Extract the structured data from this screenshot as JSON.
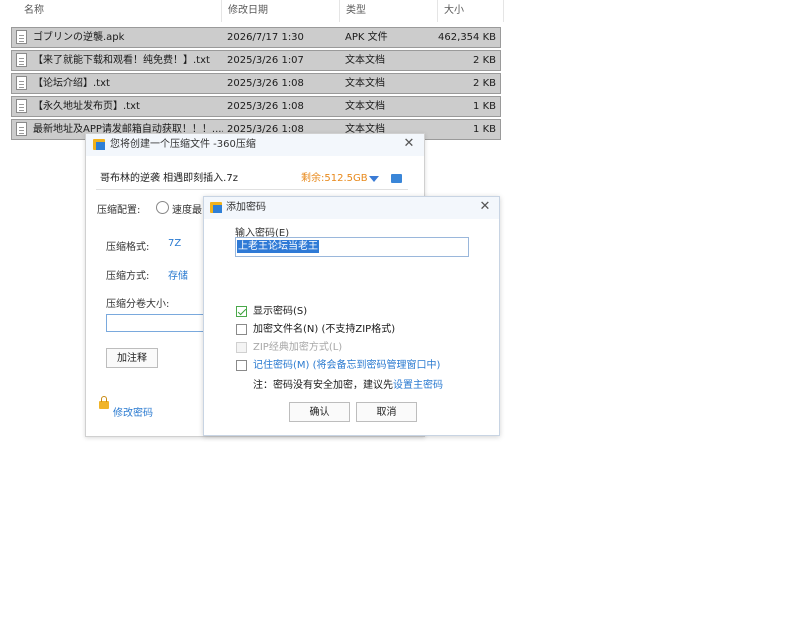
{
  "explorer": {
    "columns": [
      "名称",
      "修改日期",
      "类型",
      "大小"
    ],
    "sort_indicator": "^",
    "files": [
      {
        "name": "ゴブリンの逆襲.apk",
        "date": "2026/7/17 1:30",
        "type": "APK 文件",
        "size": "462,354 KB"
      },
      {
        "name": "【来了就能下载和观看！纯免费！】.txt",
        "date": "2025/3/26 1:07",
        "type": "文本文档",
        "size": "2 KB"
      },
      {
        "name": "【论坛介绍】.txt",
        "date": "2025/3/26 1:08",
        "type": "文本文档",
        "size": "2 KB"
      },
      {
        "name": "【永久地址发布页】.txt",
        "date": "2025/3/26 1:08",
        "type": "文本文档",
        "size": "1 KB"
      },
      {
        "name": "最新地址及APP请发邮箱自动获取！！！....",
        "date": "2025/3/26 1:08",
        "type": "文本文档",
        "size": "1 KB"
      }
    ]
  },
  "compress_dialog": {
    "title": "您将创建一个压缩文件 -360压缩",
    "close": "✕",
    "archive_name": "哥布林的逆袭 相遇即刻插入.7z",
    "free_space": "剩余:512.5GB",
    "config_label": "压缩配置:",
    "speed_option": "速度最",
    "format_label": "压缩格式:",
    "format_value": "7Z",
    "method_label": "压缩方式:",
    "method_value": "存储",
    "volume_label": "压缩分卷大小:",
    "comment_button": "加注释",
    "change_password_link": "修改密码"
  },
  "password_dialog": {
    "title": "添加密码",
    "close": "✕",
    "prompt": "输入密码(E)",
    "password_value": "上老王论坛当老王",
    "show_password": {
      "label": "显示密码(S)",
      "checked": true
    },
    "encrypt_filenames": {
      "label": "加密文件名(N) (不支持ZIP格式)",
      "checked": false
    },
    "zip_classic": {
      "label": "ZIP经典加密方式(L)",
      "checked": false,
      "disabled": true
    },
    "remember_password": {
      "label": "记住密码(M) (将会备忘到密码管理窗口中)",
      "checked": false
    },
    "note_prefix": "注：密码没有安全加密，建议先",
    "note_link": "设置主密码",
    "ok_button": "确认",
    "cancel_button": "取消"
  },
  "colors": {
    "accent": "#2a7ad0",
    "free_space": "#e8891b",
    "selection": "#2f7ad6",
    "row_selected": "#cccccc"
  }
}
